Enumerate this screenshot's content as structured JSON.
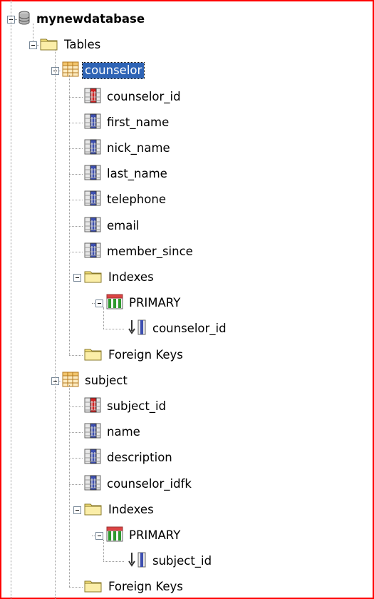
{
  "tree": {
    "database": {
      "label": "mynewdatabase",
      "icon": "database-icon"
    },
    "tables_folder": {
      "label": "Tables",
      "icon": "folder-icon"
    },
    "tables": [
      {
        "label": "counselor",
        "icon": "table-icon",
        "selected": true,
        "columns": [
          {
            "label": "counselor_id",
            "icon": "primary-key-column-icon"
          },
          {
            "label": "first_name",
            "icon": "column-icon"
          },
          {
            "label": "nick_name",
            "icon": "column-icon"
          },
          {
            "label": "last_name",
            "icon": "column-icon"
          },
          {
            "label": "telephone",
            "icon": "column-icon"
          },
          {
            "label": "email",
            "icon": "column-icon"
          },
          {
            "label": "member_since",
            "icon": "column-icon"
          }
        ],
        "indexes_folder": {
          "label": "Indexes",
          "icon": "folder-icon"
        },
        "index": {
          "label": "PRIMARY",
          "icon": "index-icon"
        },
        "index_column": {
          "label": "counselor_id",
          "icon": "index-column-icon"
        },
        "foreign_keys_folder": {
          "label": "Foreign Keys",
          "icon": "folder-icon"
        }
      },
      {
        "label": "subject",
        "icon": "table-icon",
        "selected": false,
        "columns": [
          {
            "label": "subject_id",
            "icon": "primary-key-column-icon"
          },
          {
            "label": "name",
            "icon": "column-icon"
          },
          {
            "label": "description",
            "icon": "column-icon"
          },
          {
            "label": "counselor_idfk",
            "icon": "column-icon"
          }
        ],
        "indexes_folder": {
          "label": "Indexes",
          "icon": "folder-icon"
        },
        "index": {
          "label": "PRIMARY",
          "icon": "index-icon"
        },
        "index_column": {
          "label": "subject_id",
          "icon": "index-column-icon"
        },
        "foreign_keys_folder": {
          "label": "Foreign Keys",
          "icon": "folder-icon"
        }
      }
    ]
  },
  "colors": {
    "selection": "#2f64b5",
    "frame": "#ff0000",
    "folder": "#f6e27a",
    "table": "#f2c46b",
    "primary_key": "#d22020",
    "column": "#3d4fb0",
    "index": "#2e9a2e"
  }
}
